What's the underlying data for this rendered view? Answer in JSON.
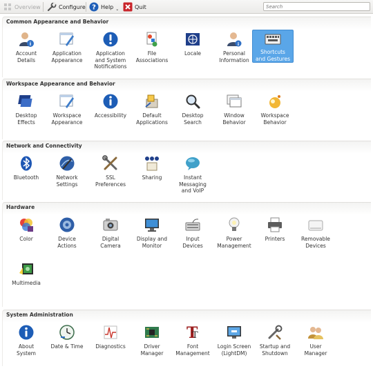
{
  "toolbar": {
    "overview": "Overview",
    "configure": "Configure",
    "help": "Help",
    "quit": "Quit",
    "search_placeholder": "Search"
  },
  "sections": [
    {
      "title": "Common Appearance and Behavior",
      "items": [
        {
          "label": "Account\nDetails",
          "icon": "account-details-icon"
        },
        {
          "label": "Application\nAppearance",
          "icon": "application-appearance-icon"
        },
        {
          "label": "Application\nand System\nNotifications",
          "icon": "notifications-icon"
        },
        {
          "label": "File\nAssociations",
          "icon": "file-associations-icon"
        },
        {
          "label": "Locale",
          "icon": "locale-icon"
        },
        {
          "label": "Personal\nInformation",
          "icon": "personal-information-icon"
        },
        {
          "label": "Shortcuts\nand Gestures",
          "icon": "shortcuts-icon",
          "selected": true
        }
      ]
    },
    {
      "title": "Workspace Appearance and Behavior",
      "items": [
        {
          "label": "Desktop\nEffects",
          "icon": "desktop-effects-icon"
        },
        {
          "label": "Workspace\nAppearance",
          "icon": "workspace-appearance-icon"
        },
        {
          "label": "Accessibility",
          "icon": "accessibility-icon"
        },
        {
          "label": "Default\nApplications",
          "icon": "default-applications-icon"
        },
        {
          "label": "Desktop\nSearch",
          "icon": "desktop-search-icon"
        },
        {
          "label": "Window\nBehavior",
          "icon": "window-behavior-icon"
        },
        {
          "label": "Workspace\nBehavior",
          "icon": "workspace-behavior-icon"
        }
      ]
    },
    {
      "title": "Network and Connectivity",
      "items": [
        {
          "label": "Bluetooth",
          "icon": "bluetooth-icon"
        },
        {
          "label": "Network\nSettings",
          "icon": "network-settings-icon"
        },
        {
          "label": "SSL\nPreferences",
          "icon": "ssl-preferences-icon"
        },
        {
          "label": "Sharing",
          "icon": "sharing-icon"
        },
        {
          "label": "Instant\nMessaging\nand VoIP",
          "icon": "instant-messaging-icon"
        }
      ]
    },
    {
      "title": "Hardware",
      "items": [
        {
          "label": "Color",
          "icon": "color-icon"
        },
        {
          "label": "Device\nActions",
          "icon": "device-actions-icon"
        },
        {
          "label": "Digital\nCamera",
          "icon": "digital-camera-icon"
        },
        {
          "label": "Display and\nMonitor",
          "icon": "display-monitor-icon"
        },
        {
          "label": "Input\nDevices",
          "icon": "input-devices-icon"
        },
        {
          "label": "Power\nManagement",
          "icon": "power-management-icon"
        },
        {
          "label": "Printers",
          "icon": "printers-icon"
        },
        {
          "label": "Removable\nDevices",
          "icon": "removable-devices-icon"
        },
        {
          "label": "Multimedia",
          "icon": "multimedia-icon"
        }
      ]
    },
    {
      "title": "System Administration",
      "items": [
        {
          "label": "About\nSystem",
          "icon": "about-system-icon"
        },
        {
          "label": "Date & Time",
          "icon": "date-time-icon"
        },
        {
          "label": "Diagnostics",
          "icon": "diagnostics-icon"
        },
        {
          "label": "Driver\nManager",
          "icon": "driver-manager-icon"
        },
        {
          "label": "Font\nManagement",
          "icon": "font-management-icon"
        },
        {
          "label": "Login Screen\n(LightDM)",
          "icon": "login-screen-icon"
        },
        {
          "label": "Startup and\nShutdown",
          "icon": "startup-shutdown-icon"
        },
        {
          "label": "User\nManager",
          "icon": "user-manager-icon"
        }
      ]
    }
  ]
}
